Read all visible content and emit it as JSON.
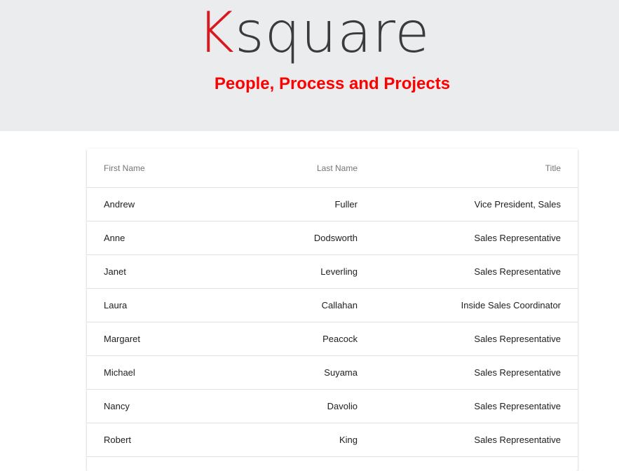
{
  "header": {
    "logo_k": "K",
    "logo_rest": "square",
    "tagline": "People, Process and Projects",
    "logo_color": "#d8171e",
    "tagline_color": "#ff0000",
    "background": "#ebeced"
  },
  "table": {
    "columns": [
      "First Name",
      "Last Name",
      "Title"
    ],
    "rows": [
      {
        "first": "Andrew",
        "last": "Fuller",
        "title": "Vice President, Sales"
      },
      {
        "first": "Anne",
        "last": "Dodsworth",
        "title": "Sales Representative"
      },
      {
        "first": "Janet",
        "last": "Leverling",
        "title": "Sales Representative"
      },
      {
        "first": "Laura",
        "last": "Callahan",
        "title": "Inside Sales Coordinator"
      },
      {
        "first": "Margaret",
        "last": "Peacock",
        "title": "Sales Representative"
      },
      {
        "first": "Michael",
        "last": "Suyama",
        "title": "Sales Representative"
      },
      {
        "first": "Nancy",
        "last": "Davolio",
        "title": "Sales Representative"
      },
      {
        "first": "Robert",
        "last": "King",
        "title": "Sales Representative"
      }
    ]
  }
}
